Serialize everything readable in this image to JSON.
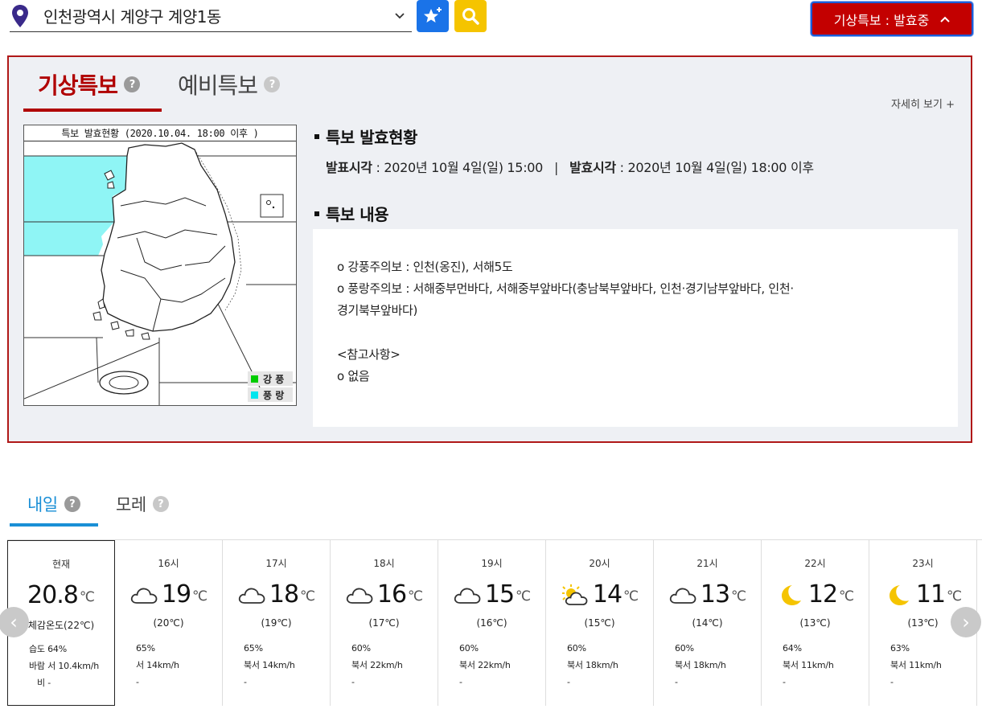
{
  "location": {
    "text": "인천광역시 계양구 계양1동",
    "icon": "map-pin-icon"
  },
  "header": {
    "alert_button_label": "기상특보 : 발효중",
    "alert_chevron": "^"
  },
  "warning_panel": {
    "tab_active": "기상특보",
    "tab_inactive": "예비특보",
    "help_glyph": "?",
    "more_link": "자세히 보기 +",
    "map_title": "특보 발효현황 (2020.10.04. 18:00 이후 )",
    "legend": [
      {
        "label": "강 풍",
        "color": "#00cc00"
      },
      {
        "label": "풍 랑",
        "color": "#00e5ee"
      }
    ],
    "status_heading": "특보 발효현황",
    "announce_label": "발표시각",
    "announce_value": " : 2020년 10월 4일(일) 15:00",
    "separator": "|",
    "effective_label": "발효시각",
    "effective_value": " : 2020년 10월 4일(일) 18:00 이후",
    "content_heading": "특보 내용",
    "content_lines": [
      "o 강풍주의보 : 인천(옹진), 서해5도",
      "o 풍랑주의보 : 서해중부먼바다, 서해중부앞바다(충남북부앞바다, 인천·경기남부앞바다, 인천·",
      "경기북부앞바다)",
      "",
      "<참고사항>",
      "o 없음"
    ]
  },
  "forecast_tabs": {
    "tomorrow": "내일",
    "day_after": "모레",
    "help_glyph": "?"
  },
  "hourly": [
    {
      "time": "현재",
      "temp": "20.8",
      "unit": "℃",
      "icon": "none",
      "feel": "체감온도(22℃)",
      "humidity": "습도 64%",
      "wind": "바람 서 10.4km/h",
      "rain": "비 -"
    },
    {
      "time": "16시",
      "temp": "19",
      "unit": "℃",
      "icon": "cloud-icon",
      "feel": "(20℃)",
      "humidity": "65%",
      "wind": "서 14km/h",
      "rain": "-"
    },
    {
      "time": "17시",
      "temp": "18",
      "unit": "℃",
      "icon": "cloud-icon",
      "feel": "(19℃)",
      "humidity": "65%",
      "wind": "북서 14km/h",
      "rain": "-"
    },
    {
      "time": "18시",
      "temp": "16",
      "unit": "℃",
      "icon": "cloud-icon",
      "feel": "(17℃)",
      "humidity": "60%",
      "wind": "북서 22km/h",
      "rain": "-"
    },
    {
      "time": "19시",
      "temp": "15",
      "unit": "℃",
      "icon": "cloud-icon",
      "feel": "(16℃)",
      "humidity": "60%",
      "wind": "북서 22km/h",
      "rain": "-"
    },
    {
      "time": "20시",
      "temp": "14",
      "unit": "℃",
      "icon": "sun-cloud-icon",
      "feel": "(15℃)",
      "humidity": "60%",
      "wind": "북서 18km/h",
      "rain": "-"
    },
    {
      "time": "21시",
      "temp": "13",
      "unit": "℃",
      "icon": "cloud-icon",
      "feel": "(14℃)",
      "humidity": "60%",
      "wind": "북서 18km/h",
      "rain": "-"
    },
    {
      "time": "22시",
      "temp": "12",
      "unit": "℃",
      "icon": "moon-icon",
      "feel": "(13℃)",
      "humidity": "64%",
      "wind": "북서 11km/h",
      "rain": "-"
    },
    {
      "time": "23시",
      "temp": "11",
      "unit": "℃",
      "icon": "moon-icon",
      "feel": "(13℃)",
      "humidity": "63%",
      "wind": "북서 11km/h",
      "rain": "-"
    }
  ],
  "nav": {
    "prev": "‹",
    "next": "›"
  },
  "colors": {
    "alert_red": "#c30000",
    "accent_blue": "#1a8fd6",
    "fav_blue": "#1a73e8",
    "search_yellow": "#f5c400",
    "sea_warning_cyan": "#8ff5f5"
  }
}
